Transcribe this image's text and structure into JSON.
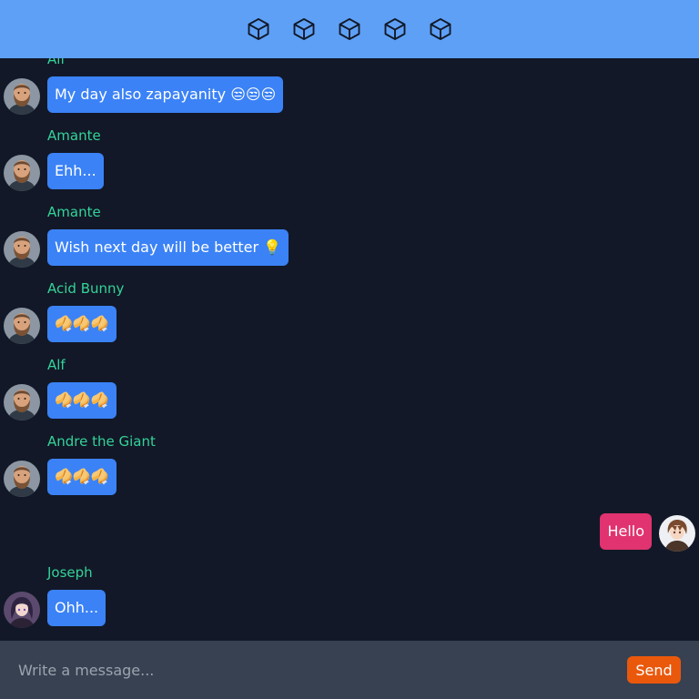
{
  "header": {
    "icons": [
      "cube-icon",
      "cube-icon",
      "cube-icon",
      "cube-icon",
      "cube-icon"
    ]
  },
  "messages": [
    {
      "sender": "Alf",
      "text": "My day also zapayanity 😒😒😒",
      "avatar": "man-bearded-avatar",
      "direction": "incoming"
    },
    {
      "sender": "Amante",
      "text": "Ehh...",
      "avatar": "man-bearded-avatar",
      "direction": "incoming"
    },
    {
      "sender": "Amante",
      "text": "Wish next day will be better 💡",
      "avatar": "man-bearded-avatar",
      "direction": "incoming"
    },
    {
      "sender": "Acid Bunny",
      "text": "🥠🥠🥠",
      "avatar": "man-bearded-avatar",
      "direction": "incoming"
    },
    {
      "sender": "Alf",
      "text": "🥠🥠🥠",
      "avatar": "man-bearded-avatar",
      "direction": "incoming"
    },
    {
      "sender": "Andre the Giant",
      "text": "🥠🥠🥠",
      "avatar": "man-bearded-avatar",
      "direction": "incoming"
    },
    {
      "sender": "",
      "text": "Hello",
      "avatar": "anime-user-avatar",
      "direction": "outgoing"
    },
    {
      "sender": "Joseph",
      "text": "Ohh...",
      "avatar": "anime-girl-avatar",
      "direction": "incoming"
    }
  ],
  "composer": {
    "placeholder": "Write a message...",
    "value": "",
    "send_label": "Send"
  },
  "colors": {
    "header_bg": "#5ea0f6",
    "page_bg": "#121827",
    "incoming_bubble": "#3b82f6",
    "outgoing_bubble": "#e0336f",
    "sender_name": "#34d399",
    "composer_bg": "#374151",
    "send_button": "#ea580c"
  }
}
